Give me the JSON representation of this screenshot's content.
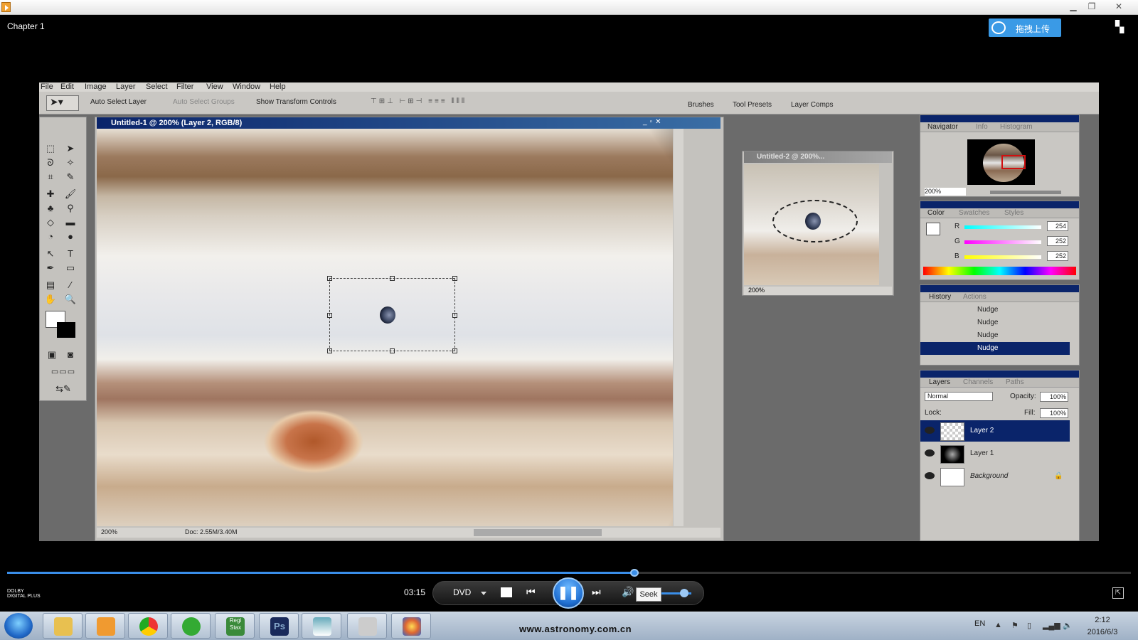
{
  "window": {
    "chapter": "Chapter 1",
    "upload_label": "拖拽上传",
    "min": "▁",
    "restore": "❐",
    "close": "✕"
  },
  "photoshop": {
    "menu": [
      "File",
      "Edit",
      "Image",
      "Layer",
      "Select",
      "Filter",
      "View",
      "Window",
      "Help"
    ],
    "options": {
      "auto_select_layer": "Auto Select Layer",
      "auto_select_groups": "Auto Select Groups",
      "show_transform": "Show Transform Controls"
    },
    "palette_well": [
      "Brushes",
      "Tool Presets",
      "Layer Comps"
    ],
    "doc1": {
      "title": "Untitled-1 @ 200% (Layer 2, RGB/8)",
      "zoom": "200%",
      "doc_size": "Doc: 2.55M/3.40M"
    },
    "doc2": {
      "title": "Untitled-2 @ 200%...",
      "zoom": "200%"
    },
    "navigator": {
      "tabs": [
        "Navigator",
        "Info",
        "Histogram"
      ],
      "zoom": "200%"
    },
    "color": {
      "tabs": [
        "Color",
        "Swatches",
        "Styles"
      ],
      "r_label": "R",
      "g_label": "G",
      "b_label": "B",
      "r": "254",
      "g": "252",
      "b": "252"
    },
    "history": {
      "tabs": [
        "History",
        "Actions"
      ],
      "items": [
        "Nudge",
        "Nudge",
        "Nudge",
        "Nudge"
      ]
    },
    "layers": {
      "tabs": [
        "Layers",
        "Channels",
        "Paths"
      ],
      "blend": "Normal",
      "opacity_label": "Opacity:",
      "opacity": "100%",
      "lock_label": "Lock:",
      "fill_label": "Fill:",
      "fill": "100%",
      "items": [
        "Layer 2",
        "Layer 1",
        "Background"
      ]
    }
  },
  "player": {
    "time": "03:15",
    "source": "DVD",
    "seek_tooltip": "Seek",
    "progress_fraction": 0.558,
    "volume_fraction": 0.85,
    "dolby": "DOLBY\nDIGITAL PLUS"
  },
  "taskbar": {
    "url": "www.astronomy.com.cn",
    "lang": "EN",
    "time": "2:12",
    "date": "2016/6/3",
    "apps": [
      "Explorer",
      "Player",
      "Chrome",
      "uTorrent",
      "RegiStax",
      "Ps",
      "Photos",
      "Scanner",
      "Paint"
    ],
    "registax_label": "Regi\nStax",
    "ps_label": "Ps"
  },
  "icons": [
    "start-orb-icon",
    "folder-icon",
    "media-player-icon",
    "chrome-icon",
    "utorrent-icon",
    "photoshop-icon",
    "fullscreen-icon",
    "speaker-icon",
    "eye-icon"
  ]
}
